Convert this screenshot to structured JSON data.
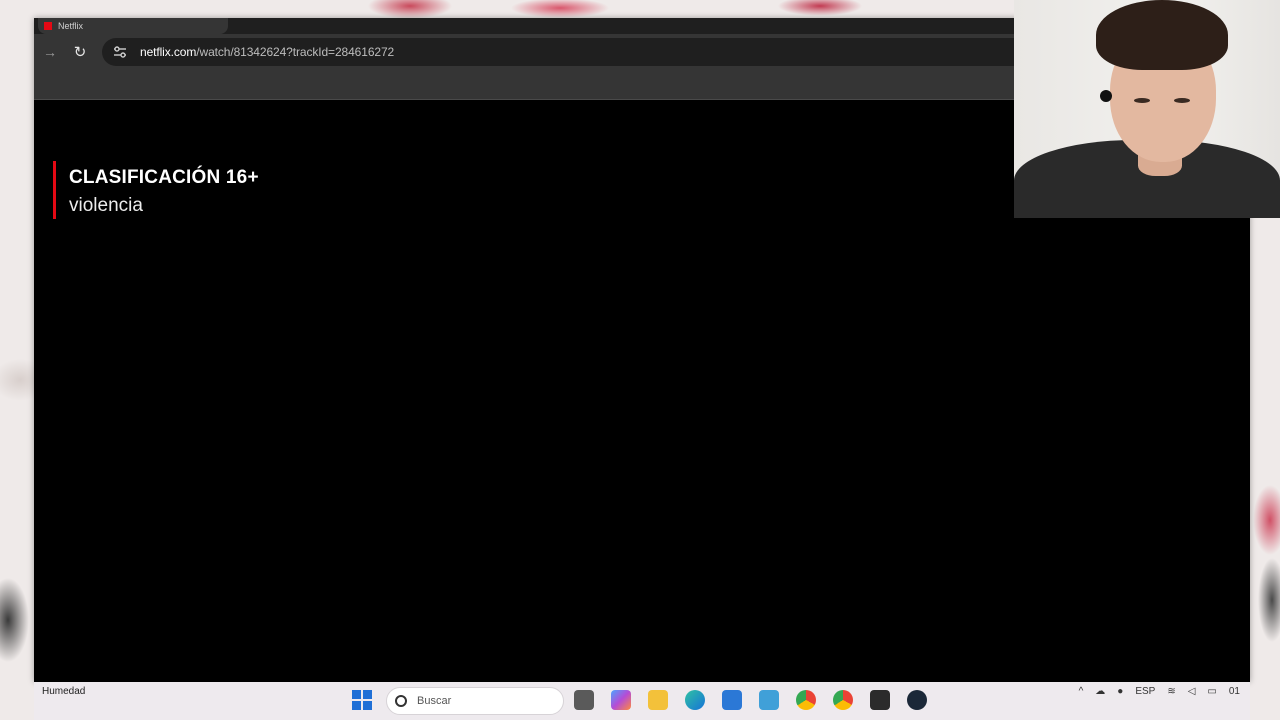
{
  "browser": {
    "tab": {
      "title": "Netflix"
    },
    "url": {
      "host": "netflix.com",
      "path": "/watch/81342624?trackId=284616272"
    },
    "nav": {
      "forward_icon": "arrow-right-icon",
      "reload_icon": "reload-icon",
      "site_info_icon": "tune-icon"
    }
  },
  "player": {
    "rating_title": "CLASIFICACIÓN 16+",
    "rating_descriptor": "violencia",
    "accent_color": "#e50914"
  },
  "taskbar": {
    "weather_label": "Humedad",
    "search_placeholder": "Buscar",
    "language": "ESP",
    "clock_fragment": "01",
    "apps": [
      "task-view-icon",
      "copilot-icon",
      "file-explorer-icon",
      "edge-icon",
      "store-icon",
      "notepad-icon",
      "chrome-icon",
      "chrome-profile-icon",
      "discord-icon",
      "steam-icon"
    ]
  }
}
